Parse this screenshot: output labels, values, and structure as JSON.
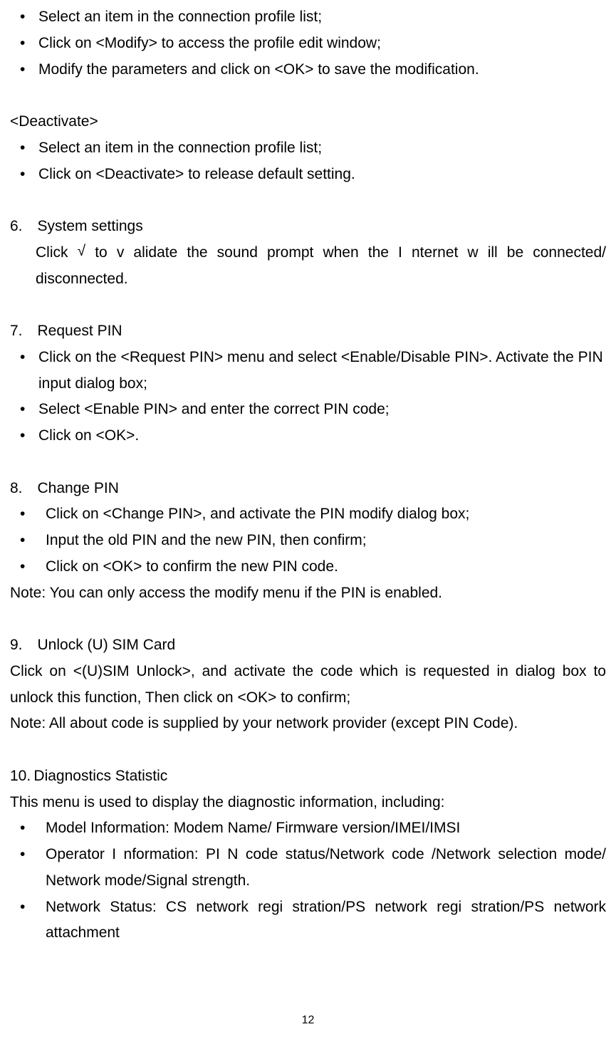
{
  "section_modify": {
    "bullets": [
      "Select an item in the connection profile list;",
      "Click on <Modify> to access the profile edit window;",
      "Modify the parameters and click on <OK> to save the modification."
    ]
  },
  "section_deactivate": {
    "title": "<Deactivate>",
    "bullets": [
      "Select an item in the connection profile list;",
      "Click on <Deactivate> to release default setting."
    ]
  },
  "section6": {
    "title": "6. System settings",
    "body_prefix": "Click ",
    "checkbox": "√",
    "body_suffix": " to v alidate the sound   prompt when the I    nternet w ill be connected/ disconnected."
  },
  "section7": {
    "title": "7. Request PIN",
    "bullets": [
      "Click on the <Request PIN> menu and select <Enable/Disable PIN>. Activate the PIN input dialog box;",
      "Select <Enable PIN> and enter the correct PIN code;",
      "Click on <OK>."
    ]
  },
  "section8": {
    "title": "8. Change PIN",
    "bullets": [
      "Click on <Change PIN>, and activate the PIN modify dialog box;",
      "Input the old PIN and the new PIN, then confirm;",
      "Click on <OK> to confirm the new PIN code."
    ],
    "note": "Note: You can only access the modify menu if the PIN is enabled."
  },
  "section9": {
    "title": "9. Unlock (U) SIM Card",
    "body": "Click on <(U)SIM Unlock>, and activate the code which is requested in dialog box to unlock this function, Then click on <OK> to confirm;",
    "note": "Note: All about code is supplied by your network provider (except PIN Code)."
  },
  "section10": {
    "title": "10. Diagnostics Statistic",
    "intro": "This menu is used to display the diagnostic information, including:",
    "bullets": [
      "Model Information: Modem Name/ Firmware version/IMEI/IMSI",
      "Operator I  nformation: PI  N code   status/Network code    /Network selection mode/ Network mode/Signal strength.",
      "Network Status:  CS network regi  stration/PS network regi stration/PS network attachment"
    ]
  },
  "page_number": "12"
}
